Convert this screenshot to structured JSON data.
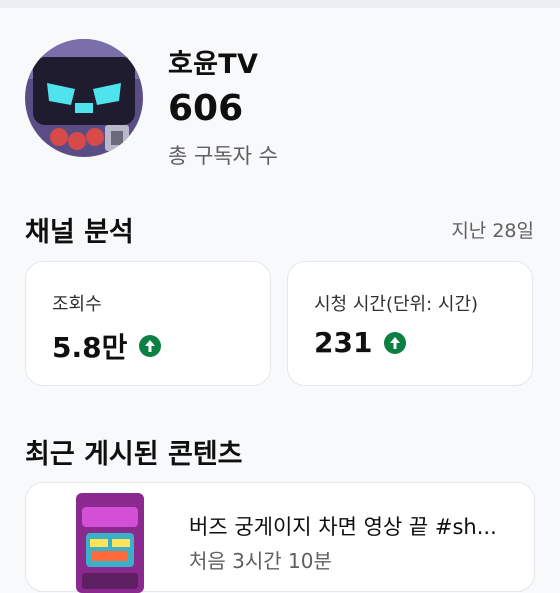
{
  "channel": {
    "name": "호윤TV",
    "subscriber_count": "606",
    "subscriber_label": "총 구독자 수",
    "avatar_icon": "robot-avatar-icon"
  },
  "analytics": {
    "title": "채널 분석",
    "period": "지난 28일",
    "cards": [
      {
        "label": "조회수",
        "value": "5.8만",
        "trend_icon": "arrow-up-icon"
      },
      {
        "label": "시청 시간(단위: 시간)",
        "value": "231",
        "trend_icon": "arrow-up-icon"
      }
    ]
  },
  "recent": {
    "title": "최근 게시된 콘텐츠",
    "items": [
      {
        "title": "버즈 궁게이지 차면 영상 끝 #sh...",
        "subtitle": "처음 3시간 10분"
      }
    ]
  },
  "colors": {
    "trend_up": "#0b8043",
    "background": "#f8f9fb",
    "card": "#ffffff",
    "secondary_text": "#606060"
  }
}
